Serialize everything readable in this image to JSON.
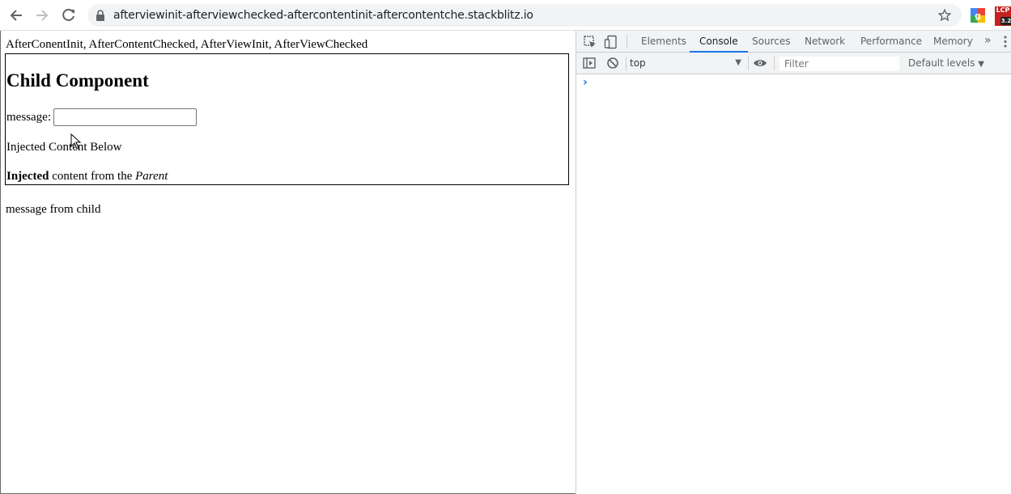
{
  "browser": {
    "url": "afterviewinit-afterviewchecked-aftercontentinit-aftercontentche.stackblitz.io",
    "extension_badge_top": "LCP",
    "extension_badge_value": "3.2"
  },
  "page": {
    "hooks_text": "AfterConentInit, AfterContentChecked, AfterViewInit, AfterViewChecked",
    "child_title": "Child Component",
    "message_label": "message:",
    "message_value": "",
    "injected_heading": "Injected Content Below",
    "injected_bold": "Injected",
    "injected_middle": " content from the ",
    "injected_italic": "Parent",
    "child_message": "message from child"
  },
  "devtools": {
    "tabs": [
      {
        "label": "Elements"
      },
      {
        "label": "Console",
        "active": true
      },
      {
        "label": "Sources"
      },
      {
        "label": "Network"
      },
      {
        "label": "Performance"
      },
      {
        "label": "Memory"
      }
    ],
    "more_tabs": "»",
    "context": "top",
    "filter_placeholder": "Filter",
    "levels": "Default levels",
    "prompt": "›"
  },
  "colors": {
    "accent": "#1a73e8",
    "toolbar_bg": "#f1f3f4"
  }
}
